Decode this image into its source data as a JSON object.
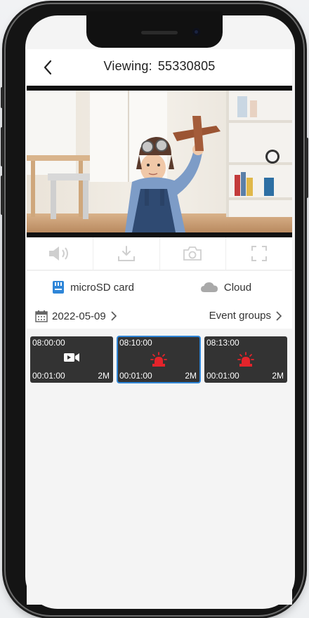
{
  "header": {
    "title_prefix": "Viewing:",
    "device_id": "55330805"
  },
  "storage": {
    "sd_label": "microSD card",
    "cloud_label": "Cloud"
  },
  "daterow": {
    "date": "2022-05-09",
    "events_label": "Event groups"
  },
  "clips": [
    {
      "start": "08:00:00",
      "duration": "00:01:00",
      "size": "2M",
      "icon": "video-camera-icon",
      "selected": false
    },
    {
      "start": "08:10:00",
      "duration": "00:01:00",
      "size": "2M",
      "icon": "alarm-siren-icon",
      "selected": true
    },
    {
      "start": "08:13:00",
      "duration": "00:01:00",
      "size": "2M",
      "icon": "alarm-siren-icon",
      "selected": false
    }
  ],
  "colors": {
    "sd_blue": "#2f86d8",
    "alarm_red": "#e4242b",
    "clip_bg": "#333333",
    "selected_outline": "#2f86d8"
  },
  "controls": [
    "speaker-icon",
    "download-icon",
    "snapshot-icon",
    "fullscreen-icon"
  ]
}
